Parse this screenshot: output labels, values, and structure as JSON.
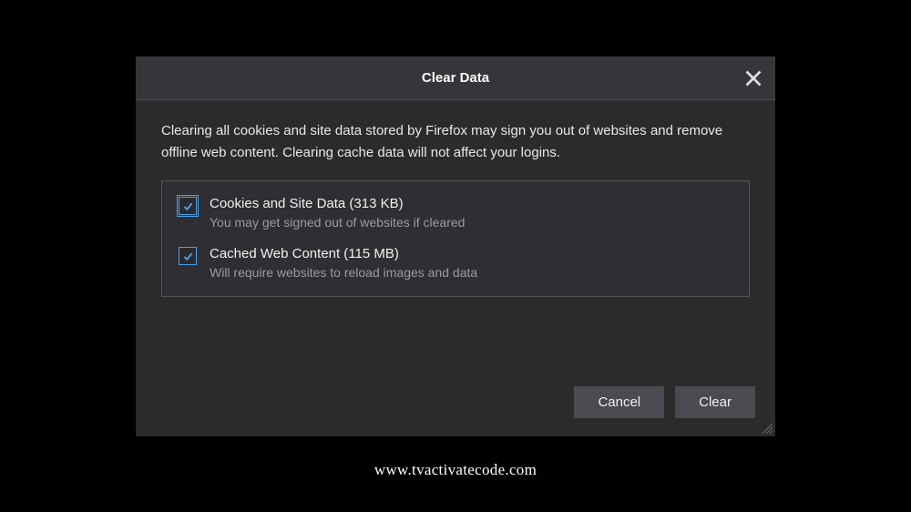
{
  "dialog": {
    "title": "Clear Data",
    "description": "Clearing all cookies and site data stored by Firefox may sign you out of websites and remove offline web content. Clearing cache data will not affect your logins.",
    "options": [
      {
        "label": "Cookies and Site Data (313 KB)",
        "description": "You may get signed out of websites if cleared"
      },
      {
        "label": "Cached Web Content (115 MB)",
        "description": "Will require websites to reload images and data"
      }
    ],
    "buttons": {
      "cancel": "Cancel",
      "clear": "Clear"
    }
  },
  "watermark": "www.tvactivatecode.com"
}
